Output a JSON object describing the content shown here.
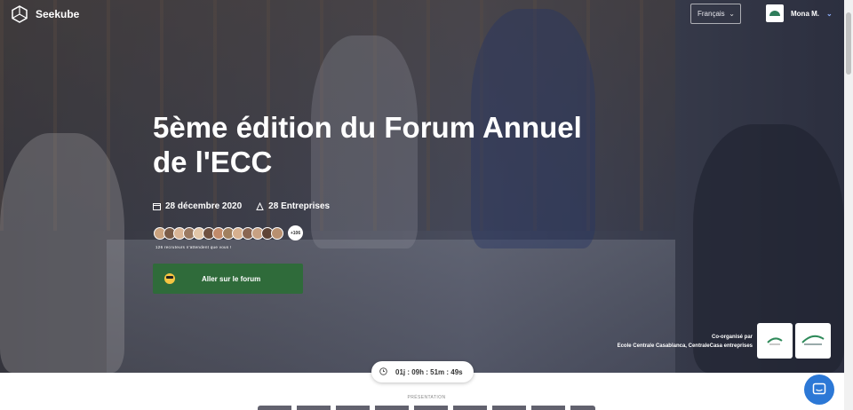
{
  "brand": {
    "name": "Seekube"
  },
  "header": {
    "language": "Français",
    "user_name": "Mona M."
  },
  "event": {
    "title_line1": "5ème édition du Forum Annuel",
    "title_line2": "de l'ECC",
    "date": "28 décembre 2020",
    "companies": "28 Entreprises",
    "avatar_more": "+106",
    "recruiters_text": "126 recruteurs n'attendent que vous !",
    "cta_label": "Aller sur le forum",
    "coorg_label": "Co-organisé par",
    "coorg_names": "Ecole Centrale Casablanca, CentraleCasa entreprises"
  },
  "countdown": {
    "text": "01j : 09h : 51m : 49s"
  },
  "section": {
    "presentation_label": "PRÉSENTATION"
  },
  "colors": {
    "cta": "#2f6b3a",
    "chat": "#2c78d6",
    "accent_blue": "#8fb2ff"
  },
  "icons": [
    "seekube-logo-icon",
    "chevron-down-icon",
    "calendar-icon",
    "building-icon",
    "sunglasses-emoji-icon",
    "clock-icon",
    "chat-icon"
  ]
}
